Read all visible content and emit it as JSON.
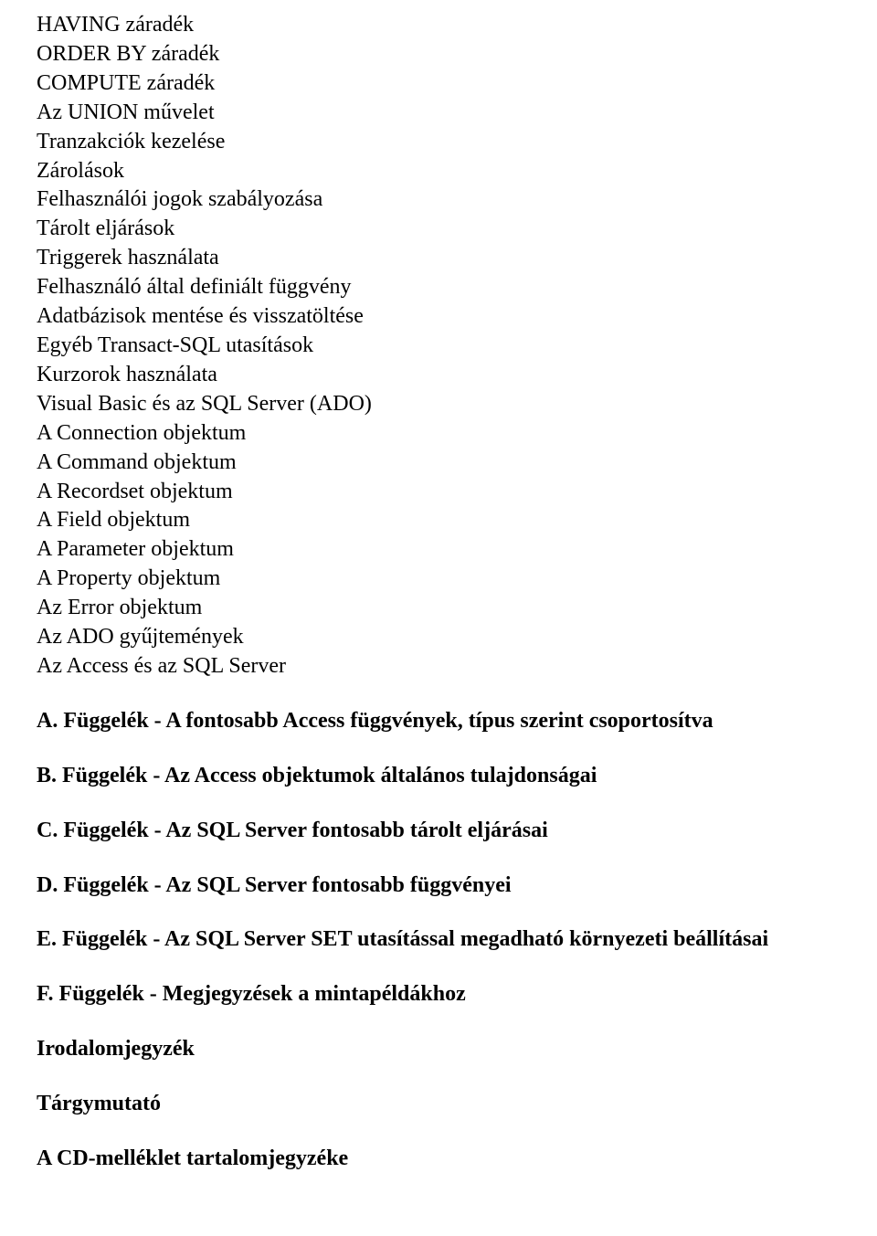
{
  "plain_lines": [
    "HAVING záradék",
    "ORDER BY záradék",
    "COMPUTE záradék",
    "Az UNION művelet",
    "Tranzakciók kezelése",
    "Zárolások",
    "Felhasználói jogok szabályozása",
    "Tárolt eljárások",
    "Triggerek használata",
    "Felhasználó által definiált függvény",
    "Adatbázisok mentése és visszatöltése",
    "Egyéb Transact-SQL utasítások",
    "Kurzorok használata",
    "Visual Basic és az SQL Server (ADO)",
    "A Connection objektum",
    "A Command objektum",
    "A Recordset objektum",
    "A Field objektum",
    "A Parameter objektum",
    "A Property objektum",
    "Az Error objektum",
    "Az ADO gyűjtemények",
    "Az Access és az SQL Server"
  ],
  "bold_lines": [
    "A. Függelék - A fontosabb Access függvények, típus  szerint csoportosítva",
    "B. Függelék - Az Access objektumok általános  tulajdonságai",
    "C. Függelék - Az SQL Server fontosabb tárolt eljárásai",
    "D. Függelék - Az SQL Server fontosabb függvényei",
    "E. Függelék - Az SQL Server SET utasítással  megadható környezeti beállításai",
    "F.  Függelék - Megjegyzések a mintapéldákhoz",
    "Irodalomjegyzék",
    "Tárgymutató",
    "A CD-melléklet tartalomjegyzéke"
  ]
}
